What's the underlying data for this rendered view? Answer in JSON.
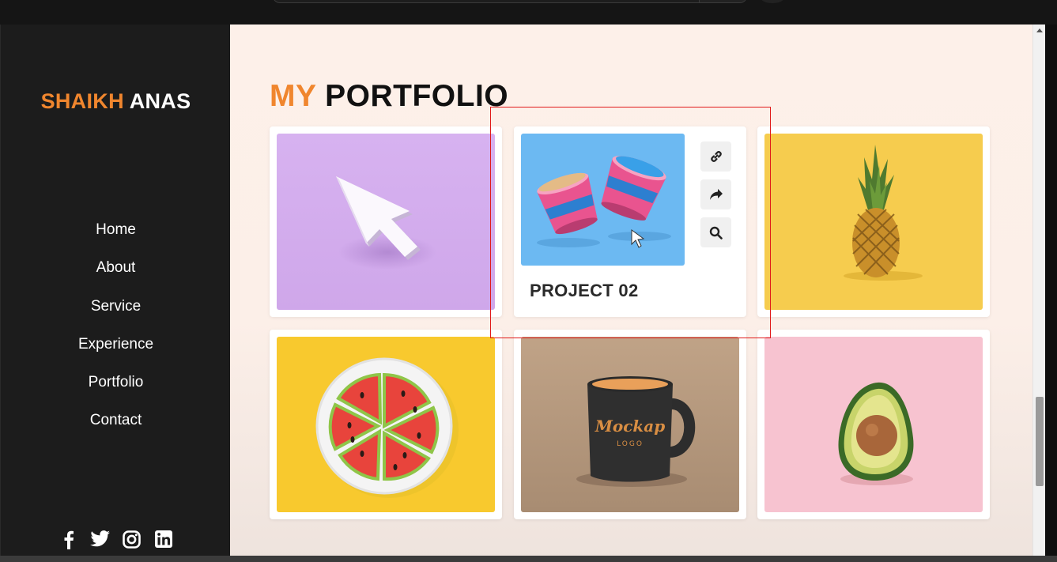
{
  "brand": {
    "first": "SHAIKH",
    "last": "ANAS"
  },
  "nav": {
    "items": [
      {
        "label": "Home"
      },
      {
        "label": "About"
      },
      {
        "label": "Service"
      },
      {
        "label": "Experience"
      },
      {
        "label": "Portfolio"
      },
      {
        "label": "Contact"
      }
    ]
  },
  "socials": [
    "facebook-icon",
    "twitter-icon",
    "instagram-icon",
    "linkedin-icon"
  ],
  "page": {
    "title_accent": "MY",
    "title_rest": "PORTFOLIO"
  },
  "projects": {
    "hovered": {
      "title": "PROJECT 02",
      "actions": [
        "link-icon",
        "share-icon",
        "search-icon"
      ]
    }
  },
  "colors": {
    "accent": "#f0862e",
    "sidebar": "#1c1c1c",
    "highlight": "#e01a1a"
  }
}
